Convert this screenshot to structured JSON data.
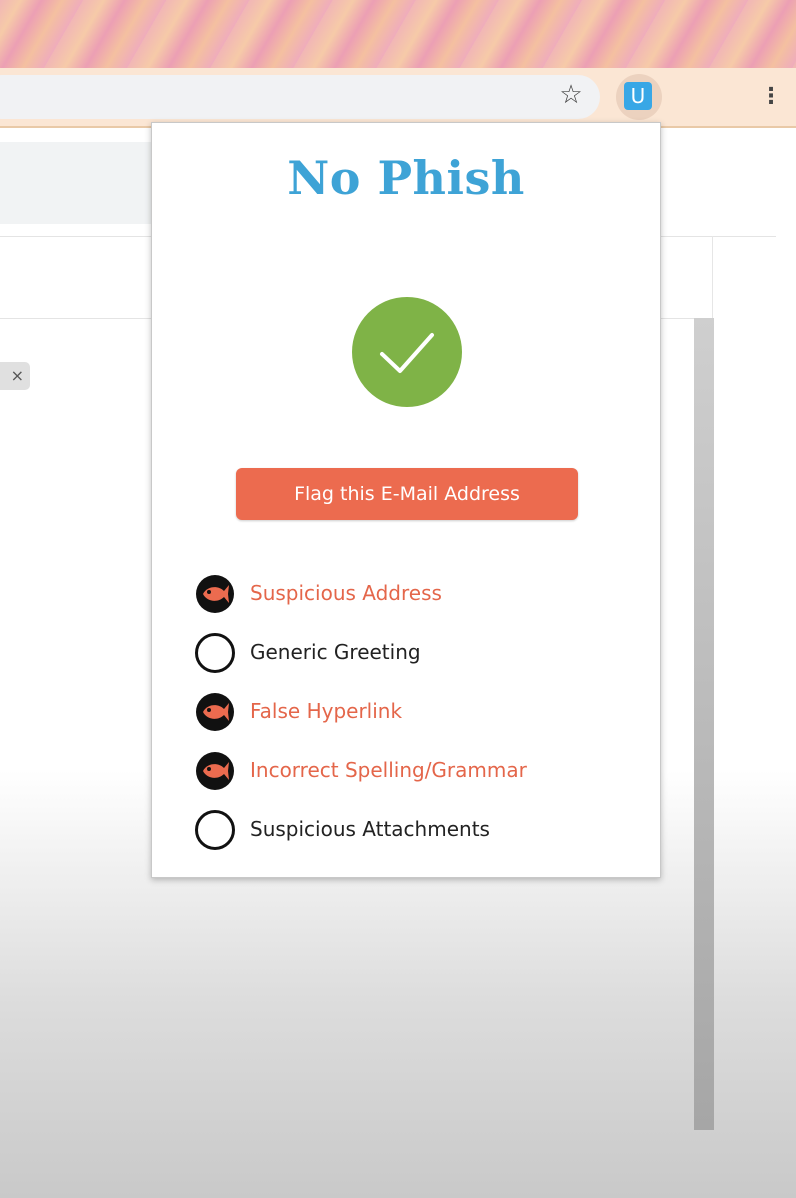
{
  "browser": {
    "star_glyph": "☆",
    "extension_glyph": "U",
    "menu_glyph": "⋮"
  },
  "page": {
    "chip_close_glyph": "×"
  },
  "popup": {
    "title": "No Phish",
    "status": "safe",
    "flag_button_label": "Flag this E-Mail Address",
    "checks": [
      {
        "label": "Suspicious Address",
        "flagged": true
      },
      {
        "label": "Generic Greeting",
        "flagged": false
      },
      {
        "label": "False Hyperlink",
        "flagged": true
      },
      {
        "label": "Incorrect Spelling/Grammar",
        "flagged": true
      },
      {
        "label": "Suspicious Attachments",
        "flagged": false
      }
    ]
  },
  "colors": {
    "title": "#3ea3d6",
    "accent": "#ec6b4f",
    "flagged_text": "#e4664a",
    "safe_green": "#7fb347",
    "extension_blue": "#38a7e6"
  }
}
